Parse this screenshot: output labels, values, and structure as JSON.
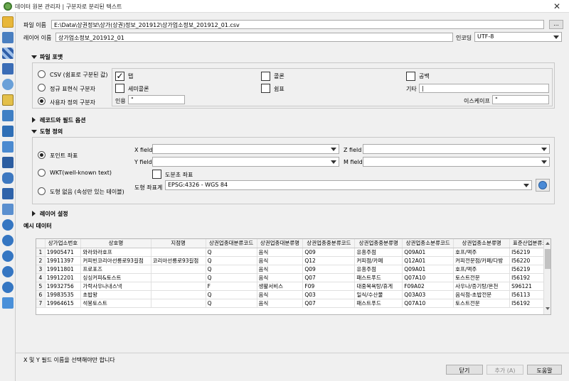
{
  "window": {
    "title": "데이터 원본 관리자 | 구분자로 분리된 텍스트"
  },
  "file": {
    "label": "파일 이름",
    "value": "E:\\Data\\상권정보\\상가(상권)정보_201912\\상가업소정보_201912_01.csv",
    "browse_label": "..."
  },
  "layer": {
    "label": "레이어 이름",
    "value": "상가업소정보_201912_01",
    "encoding_label": "인코딩",
    "encoding_value": "UTF-8"
  },
  "file_format": {
    "title": "파일 포맷",
    "csv_label": "CSV (쉼표로 구분된 값)",
    "regex_label": "정규 표현식 구분자",
    "custom_label": "사용자 정의 구분자",
    "tab_label": "탭",
    "colon_label": "콜론",
    "space_label": "공백",
    "semicolon_label": "세미콜론",
    "comma_label": "쉼표",
    "other_label": "기타",
    "other_value": "|",
    "quote_label": "인용",
    "quote_value": "\"",
    "escape_label": "이스케이프",
    "escape_value": "\""
  },
  "record_options": {
    "title": "레코드와 필드 옵션"
  },
  "geometry": {
    "title": "도형 정의",
    "point_label": "포인트 좌표",
    "wkt_label": "WKT(well-known text)",
    "none_label": "도형 없음 (속성만 있는 테이블)",
    "xfield_label": "X field",
    "yfield_label": "Y field",
    "zfield_label": "Z field",
    "mfield_label": "M field",
    "dms_label": "도분초 좌표",
    "crs_label": "도형 좌표계",
    "crs_value": "EPSG:4326 - WGS 84"
  },
  "layer_settings": {
    "title": "레이어 설정"
  },
  "sample": {
    "title": "예시 데이터",
    "headers": [
      "상가업소번호",
      "상호명",
      "지점명",
      "상권업종대분류코드",
      "상권업종대분류명",
      "상권업종중분류코드",
      "상권업종중분류명",
      "상권업종소분류코드",
      "상권업종소분류명",
      "표준산업분류코"
    ],
    "rows": [
      [
        "1",
        "19905471",
        "와라와라호프",
        "",
        "Q",
        "음식",
        "Q09",
        "유흥주점",
        "Q09A01",
        "호프/맥주",
        "I56219"
      ],
      [
        "2",
        "19911397",
        "커피빈코리아선릉로93길점",
        "코리아선릉로93길점",
        "Q",
        "음식",
        "Q12",
        "커피점/카페",
        "Q12A01",
        "커피전문점/카페/다방",
        "I56220"
      ],
      [
        "3",
        "19911801",
        "프로포즈",
        "",
        "Q",
        "음식",
        "Q09",
        "유흥주점",
        "Q09A01",
        "호프/맥주",
        "I56219"
      ],
      [
        "4",
        "19912201",
        "싱싱커피&토스트",
        "",
        "Q",
        "음식",
        "Q07",
        "패스트푸드",
        "Q07A10",
        "토스트전문",
        "I56192"
      ],
      [
        "5",
        "19932756",
        "가락사우나내스낵",
        "",
        "F",
        "생활서비스",
        "F09",
        "대중목욕탕/휴게",
        "F09A02",
        "사우나/증기탕/온천",
        "S96121"
      ],
      [
        "6",
        "19983535",
        "초밥왕",
        "",
        "Q",
        "음식",
        "Q03",
        "일식/수산물",
        "Q03A03",
        "음식점-초밥전문",
        "I56113"
      ],
      [
        "7",
        "19964615",
        "석봉토스트",
        "",
        "Q",
        "음식",
        "Q07",
        "패스트푸드",
        "Q07A10",
        "토스트전문",
        "I56192"
      ]
    ]
  },
  "status": {
    "message": "X 및 Y 필드 이름을 선택해야만 합니다"
  },
  "buttons": {
    "close": "닫기",
    "add": "추가 (A)",
    "help": "도움말"
  },
  "sidebar": {
    "icons": [
      "folder-icon",
      "vector-icon",
      "grid-icon",
      "raster-icon",
      "mesh-icon",
      "delimited-text-icon",
      "geopackage-icon",
      "spatialite-icon",
      "postgis-icon",
      "mssql-icon",
      "oracle-icon",
      "db2-icon",
      "virtual-layer-icon",
      "wms-icon",
      "wfs-icon",
      "wcs-icon",
      "xyz-icon",
      "arcgis-icon",
      "geonode-icon"
    ]
  }
}
